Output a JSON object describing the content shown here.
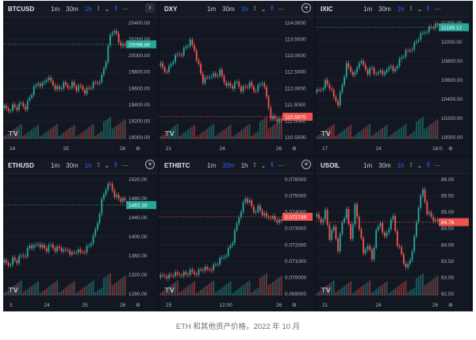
{
  "caption": "ETH 和其他资产价格，2022 年 10 月",
  "timeframes": [
    "1m",
    "30m",
    "1h"
  ],
  "toolbar_icons": [
    "indicators-icon",
    "chevron-down-icon",
    "candles-icon",
    "more-icon"
  ],
  "colors": {
    "up": "#26a69a",
    "down": "#ef5350",
    "bg": "#131722",
    "grid": "#1e222d",
    "accent": "#2962ff"
  },
  "panels": [
    {
      "symbol": "BTCUSD",
      "active_tf": "1h",
      "price": "20096.86",
      "price_color": "#26a69a",
      "extra_button": "nav-arrow",
      "y_ticks": [
        "20400.00",
        "20200.00",
        "20000.00",
        "19800.00",
        "19600.00",
        "19400.00",
        "19200.00",
        "19000.00"
      ],
      "x_ticks": [
        "24",
        "25",
        "26"
      ]
    },
    {
      "symbol": "DXY",
      "active_tf": "1h",
      "price": "110.5875",
      "price_color": "#ef5350",
      "extra_button": "plus",
      "y_ticks": [
        "114.0000",
        "113.5000",
        "113.0000",
        "112.5000",
        "112.0000",
        "111.5000",
        "111.0000",
        "110.5000"
      ],
      "x_ticks": [
        "21",
        "24",
        "26"
      ]
    },
    {
      "symbol": "IXIC",
      "active_tf": "1h",
      "price": "11199.12",
      "price_color": "#26a69a",
      "extra_button": "none",
      "y_ticks": [
        "11200.00",
        "11000.00",
        "10800.00",
        "10600.00",
        "10400.00",
        "10200.00",
        "10000.00"
      ],
      "x_ticks": [
        "17",
        "24",
        "18:0"
      ]
    },
    {
      "symbol": "ETHUSD",
      "active_tf": "1h",
      "price": "1462.18",
      "price_color": "#26a69a",
      "extra_button": "plus",
      "y_ticks": [
        "1520.00",
        "1480.00",
        "1440.00",
        "1400.00",
        "1360.00",
        "1320.00",
        "1280.00"
      ],
      "x_ticks": [
        "3",
        "24",
        "25",
        "26"
      ]
    },
    {
      "symbol": "ETHBTC",
      "active_tf": "30m",
      "price": "0.072749",
      "price_color": "#ef5350",
      "extra_button": "plus",
      "y_ticks": [
        "0.076000",
        "0.075000",
        "0.074000",
        "0.073000",
        "0.072000",
        "0.071000",
        "0.070000",
        "0.069000"
      ],
      "x_ticks": [
        "25",
        "12:00",
        "26"
      ]
    },
    {
      "symbol": "USOIL",
      "active_tf": "1h",
      "price": "84.76",
      "price_color": "#ef5350",
      "extra_button": "none",
      "y_ticks": [
        "86.00",
        "85.50",
        "85.00",
        "84.50",
        "84.00",
        "83.50",
        "83.00",
        "82.50"
      ],
      "x_ticks": [
        "21",
        "24",
        "26"
      ]
    }
  ]
}
